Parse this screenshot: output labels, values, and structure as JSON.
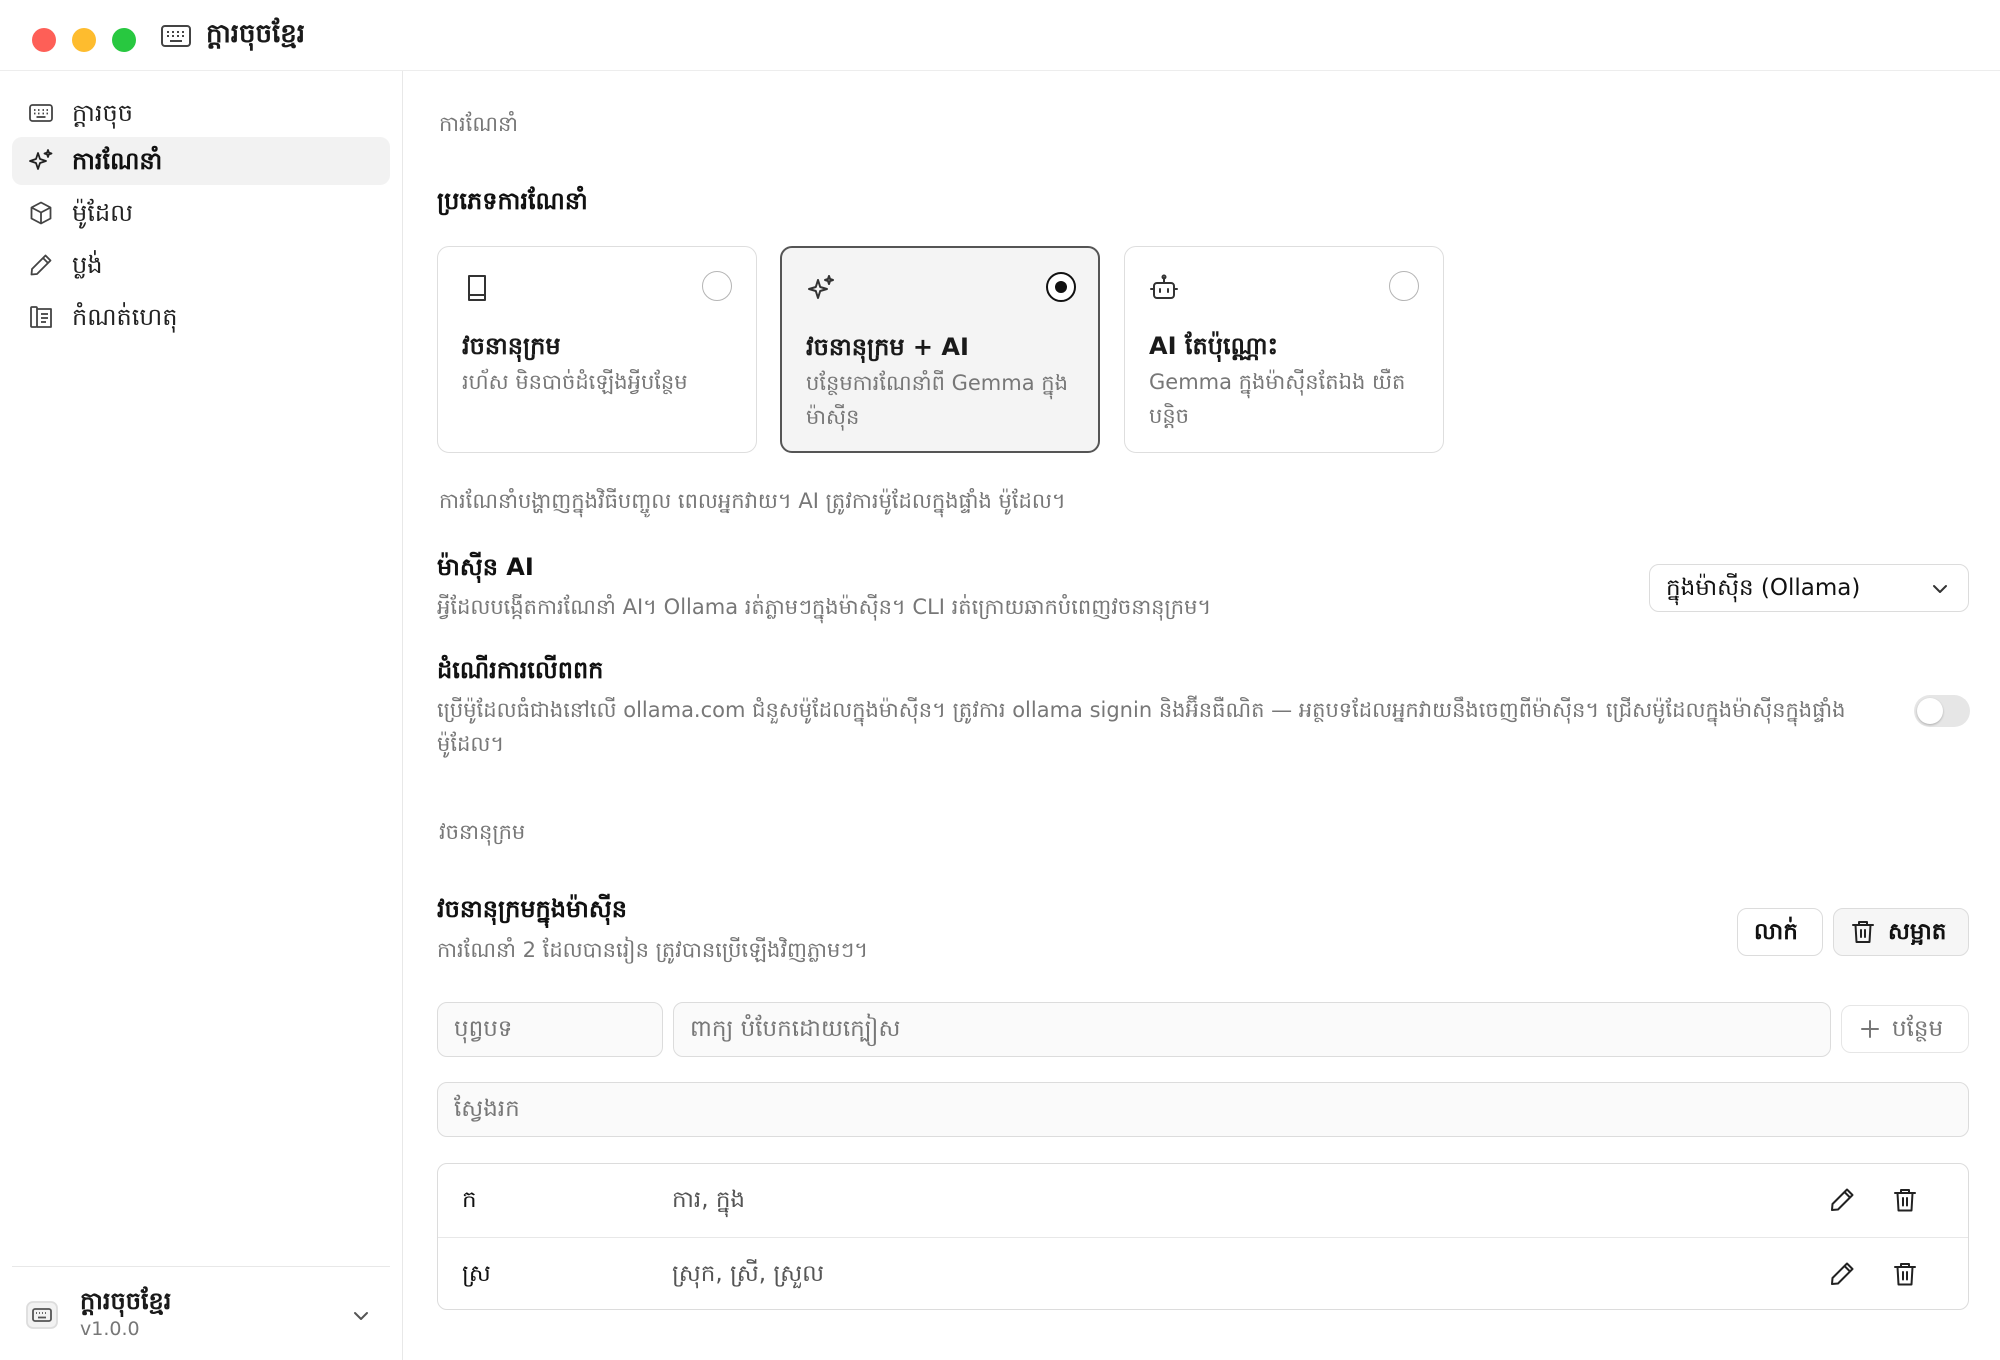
{
  "window": {
    "title": "ក្តារចុចខ្មែរ"
  },
  "sidebar": {
    "items": [
      {
        "label": "ក្តារចុច",
        "icon": "keyboard-icon"
      },
      {
        "label": "ការណែនាំ",
        "icon": "sparkles-icon",
        "active": true
      },
      {
        "label": "ម៉ូដែល",
        "icon": "cube-icon"
      },
      {
        "label": "ប្លង់",
        "icon": "pencil-icon"
      },
      {
        "label": "កំណត់ហេតុ",
        "icon": "log-icon"
      }
    ],
    "footer": {
      "app_name": "ក្តារចុចខ្មែរ",
      "version": "v1.0.0"
    }
  },
  "main": {
    "section_suggestions": "ការណែនាំ",
    "suggestion_type_heading": "ប្រភេទការណែនាំ",
    "cards": [
      {
        "title": "វចនានុក្រម",
        "description": "រហ័ស មិនបាច់ដំឡើងអ្វីបន្ថែម",
        "icon": "book-icon",
        "selected": false
      },
      {
        "title": "វចនានុក្រម + AI",
        "description": "បន្ថែមការណែនាំពី Gemma ក្នុងម៉ាស៊ីន",
        "icon": "sparkles-icon",
        "selected": true
      },
      {
        "title": "AI តែប៉ុណ្ណោះ",
        "description": "Gemma ក្នុងម៉ាស៊ីនតែឯង យឺតបន្តិច",
        "icon": "bot-icon",
        "selected": false
      }
    ],
    "type_note": "ការណែនាំបង្ហាញក្នុងវិធីបញ្ចូល ពេលអ្នកវាយ។ AI ត្រូវការម៉ូដែលក្នុងផ្ទាំង ម៉ូដែល។",
    "ai_engine": {
      "heading": "ម៉ាស៊ីន AI",
      "description": "អ្វីដែលបង្កើតការណែនាំ AI។ Ollama រត់ភ្លាមៗក្នុងម៉ាស៊ីន។ CLI រត់ក្រោយឆាកបំពេញវចនានុក្រម។",
      "selected_option": "ក្នុងម៉ាស៊ីន (Ollama)"
    },
    "cloud": {
      "heading": "ដំណើរការលើពពក",
      "description": "ប្រើម៉ូដែលធំជាងនៅលើ ollama.com ជំនួសម៉ូដែលក្នុងម៉ាស៊ីន។ ត្រូវការ ollama signin និងអ៊ីនធឺណិត — អត្ថបទដែលអ្នកវាយនឹងចេញពីម៉ាស៊ីន។ ជ្រើសម៉ូដែលក្នុងម៉ាស៊ីនក្នុងផ្ទាំង ម៉ូដែល។",
      "enabled": false
    },
    "section_dictionary": "វចនានុក្រម",
    "local_dictionary": {
      "heading": "វចនានុក្រមក្នុងម៉ាស៊ីន",
      "description": "ការណែនាំ 2 ដែលបានរៀន ត្រូវបានប្រើឡើងវិញភ្លាមៗ។",
      "import_label": "លាក់",
      "clear_label": "សម្អាត",
      "prefix_placeholder": "បុព្វបទ",
      "words_placeholder": "ពាក្យ បំបែកដោយក្បៀស",
      "add_label": "បន្ថែម",
      "search_placeholder": "ស្វែងរក",
      "rows": [
        {
          "prefix": "ក",
          "words": "ការ, ក្នុង"
        },
        {
          "prefix": "ស្រ",
          "words": "ស្រុក, ស្រី, ស្រួល"
        }
      ]
    }
  }
}
